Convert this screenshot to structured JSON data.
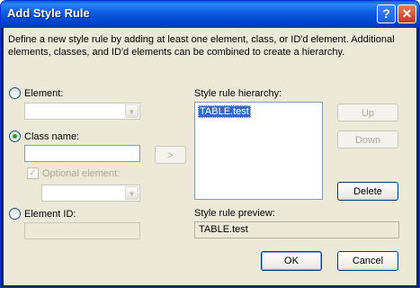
{
  "window": {
    "title": "Add Style Rule",
    "help_label": "?",
    "close_label": "✕"
  },
  "description": "Define a new style rule by adding at least one element, class, or ID'd element.  Additional elements, classes, and ID'd elements can be combined to create a hierarchy.",
  "element": {
    "label": "Element:",
    "value": ""
  },
  "class_name": {
    "label": "Class name:",
    "value": ""
  },
  "optional_element": {
    "label": "Optional element:",
    "value": ""
  },
  "element_id": {
    "label": "Element ID:",
    "value": ""
  },
  "add_button": {
    "label": ">"
  },
  "hierarchy": {
    "label": "Style rule hierarchy:",
    "items": [
      "TABLE.test"
    ]
  },
  "up_button": {
    "label": "Up"
  },
  "down_button": {
    "label": "Down"
  },
  "delete_button": {
    "label": "Delete"
  },
  "preview": {
    "label": "Style rule preview:",
    "value": "TABLE.test"
  },
  "ok_button": {
    "label": "OK"
  },
  "cancel_button": {
    "label": "Cancel"
  }
}
